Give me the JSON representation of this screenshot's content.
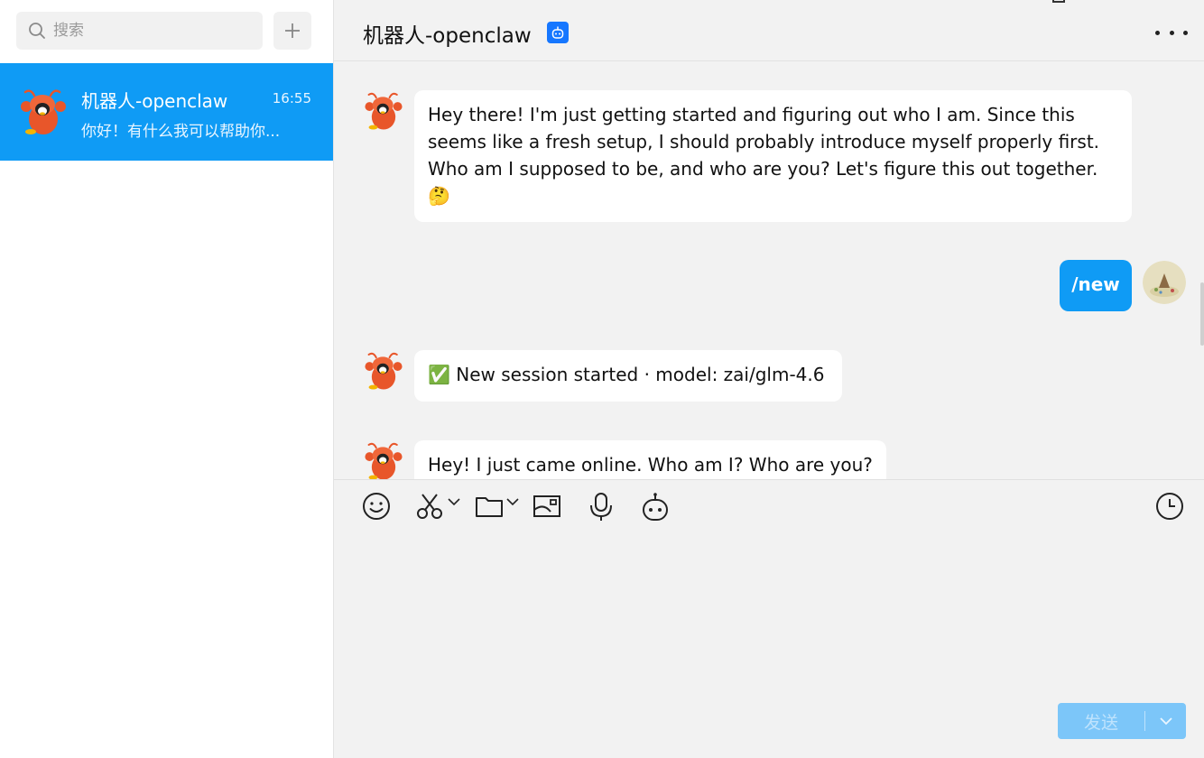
{
  "sidebar": {
    "search": {
      "placeholder": "搜索"
    },
    "chats": [
      {
        "name": "机器人-openclaw",
        "time": "16:55",
        "preview": "你好！有什么我可以帮助你..."
      }
    ]
  },
  "header": {
    "title": "机器人-openclaw"
  },
  "messages": [
    {
      "sender": "bot",
      "text": "Hey there! I'm just getting started and figuring out who I am. Since this seems like a fresh setup, I should probably introduce myself properly first. Who am I supposed to be, and who are you? Let's figure this out together.",
      "emoji": "🤔"
    },
    {
      "sender": "me",
      "text": "/new"
    },
    {
      "sender": "bot",
      "emoji": "✅",
      "text": "New session started · model: zai/glm-4.6"
    },
    {
      "sender": "bot",
      "text": "Hey! I just came online. Who am I? Who are you?"
    }
  ],
  "composer": {
    "send_label": "发送"
  },
  "colors": {
    "accent": "#0f9bf5",
    "badge": "#1677ff",
    "bot_avatar": "#e8562a"
  },
  "icons": {
    "toolbar": [
      "emoji-icon",
      "scissors-icon",
      "folder-icon",
      "screenshot-icon",
      "microphone-icon",
      "robot-icon",
      "history-clock-icon"
    ]
  }
}
